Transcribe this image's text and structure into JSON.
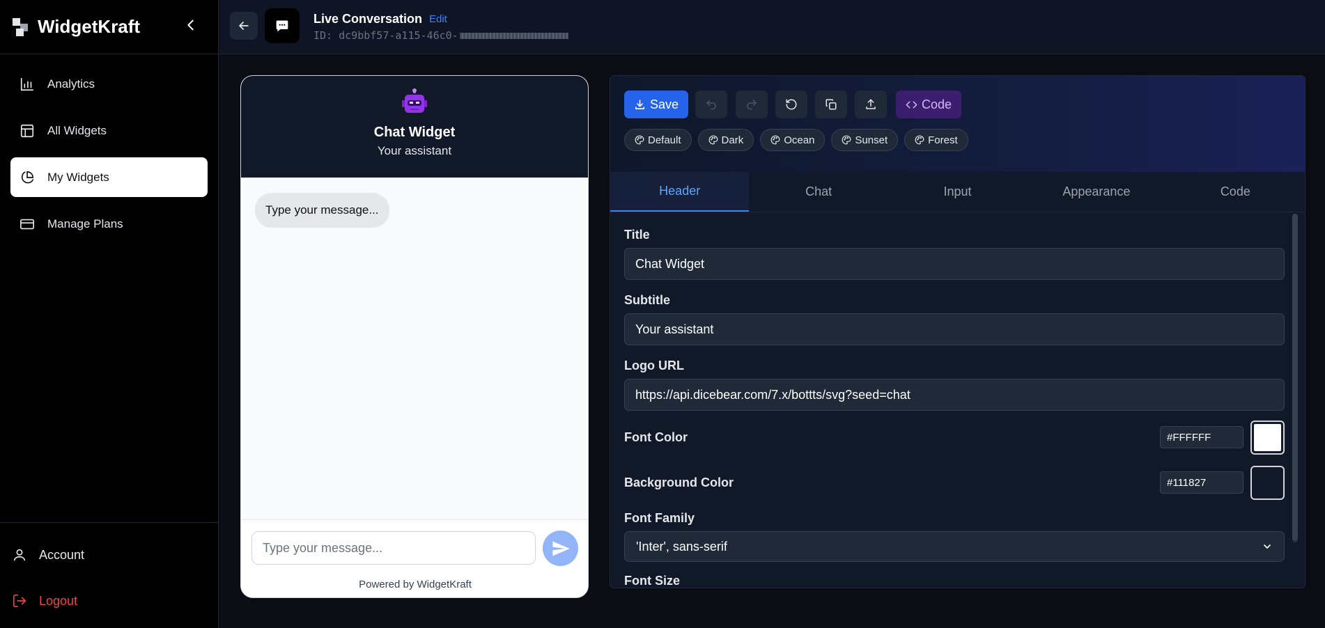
{
  "sidebar": {
    "brand": "WidgetKraft",
    "items": [
      {
        "label": "Analytics",
        "icon": "bar-chart-icon"
      },
      {
        "label": "All Widgets",
        "icon": "layout-icon"
      },
      {
        "label": "My Widgets",
        "icon": "pie-chart-icon",
        "active": true
      },
      {
        "label": "Manage Plans",
        "icon": "credit-card-icon"
      }
    ],
    "account_label": "Account",
    "logout_label": "Logout"
  },
  "topbar": {
    "title": "Live Conversation",
    "edit_label": "Edit",
    "id_prefix": "ID: dc9bbf57-a115-46c0-"
  },
  "preview": {
    "title": "Chat Widget",
    "subtitle": "Your assistant",
    "bubble": "Type your message...",
    "input_placeholder": "Type your message...",
    "powered_by": "Powered by WidgetKraft"
  },
  "toolbar": {
    "save_label": "Save",
    "code_label": "Code"
  },
  "themes": [
    "Default",
    "Dark",
    "Ocean",
    "Sunset",
    "Forest"
  ],
  "tabs": [
    "Header",
    "Chat",
    "Input",
    "Appearance",
    "Code"
  ],
  "active_tab": "Header",
  "form": {
    "title_label": "Title",
    "title_value": "Chat Widget",
    "subtitle_label": "Subtitle",
    "subtitle_value": "Your assistant",
    "logo_label": "Logo URL",
    "logo_value": "https://api.dicebear.com/7.x/bottts/svg?seed=chat",
    "font_color_label": "Font Color",
    "font_color_value": "#FFFFFF",
    "bg_color_label": "Background Color",
    "bg_color_value": "#111827",
    "font_family_label": "Font Family",
    "font_family_value": "'Inter', sans-serif",
    "font_size_label": "Font Size"
  },
  "colors": {
    "accent": "#2563eb",
    "logout": "#ef4444",
    "code_button": "#3b1f6e",
    "widget_header": "#111827",
    "send_button": "#93b4f7"
  }
}
